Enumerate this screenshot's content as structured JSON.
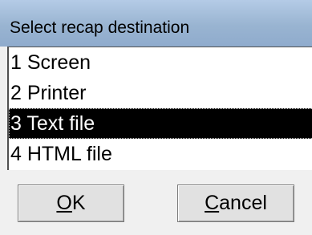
{
  "dialog": {
    "title": "Select recap destination"
  },
  "list": {
    "items": [
      {
        "label": "1 Screen",
        "selected": false
      },
      {
        "label": "2 Printer",
        "selected": false
      },
      {
        "label": "3 Text file",
        "selected": true
      },
      {
        "label": "4 HTML file",
        "selected": false
      }
    ]
  },
  "buttons": {
    "ok": {
      "accel": "O",
      "rest": "K"
    },
    "cancel": {
      "accel": "C",
      "rest": "ancel"
    }
  },
  "colors": {
    "title_bar": "#99b4d1",
    "selection_background": "#000000",
    "selection_text": "#ffffff"
  }
}
